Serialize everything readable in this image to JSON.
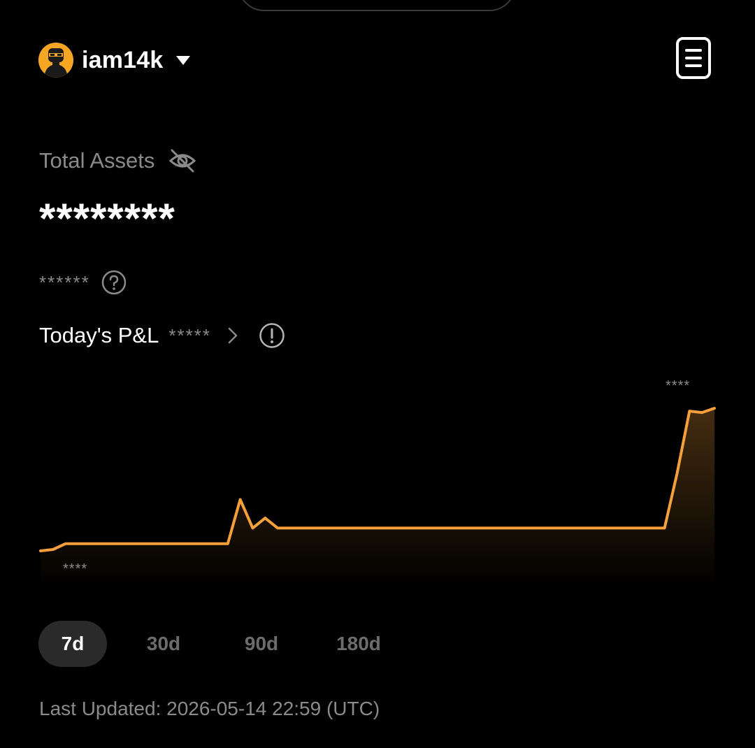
{
  "header": {
    "username": "iam14k",
    "avatar_icon": "avatar-image",
    "menu_icon": "document-list-icon"
  },
  "assets": {
    "label": "Total Assets",
    "visibility_icon": "eye-off-icon",
    "total_value": "********",
    "sub_value": "******",
    "help_icon": "question-circle-icon"
  },
  "pnl": {
    "label": "Today's P&L",
    "value": "*****",
    "chevron_icon": "chevron-right-icon",
    "info_icon": "exclamation-circle-icon"
  },
  "chart_data": {
    "type": "area",
    "max_label": "****",
    "min_label": "****",
    "color": "#f5a03a",
    "values": [
      0.0,
      0.01,
      0.05,
      0.05,
      0.05,
      0.05,
      0.05,
      0.05,
      0.05,
      0.05,
      0.05,
      0.05,
      0.05,
      0.05,
      0.05,
      0.05,
      0.36,
      0.16,
      0.23,
      0.16,
      0.16,
      0.16,
      0.16,
      0.16,
      0.16,
      0.16,
      0.16,
      0.16,
      0.16,
      0.16,
      0.16,
      0.16,
      0.16,
      0.16,
      0.16,
      0.16,
      0.16,
      0.16,
      0.16,
      0.16,
      0.16,
      0.16,
      0.16,
      0.16,
      0.16,
      0.16,
      0.16,
      0.16,
      0.16,
      0.16,
      0.16,
      0.54,
      0.98,
      0.97,
      1.0
    ]
  },
  "range": {
    "options": [
      "7d",
      "30d",
      "90d",
      "180d"
    ],
    "selected": "7d"
  },
  "footer": {
    "last_updated": "Last Updated: 2026-05-14 22:59 (UTC)"
  }
}
